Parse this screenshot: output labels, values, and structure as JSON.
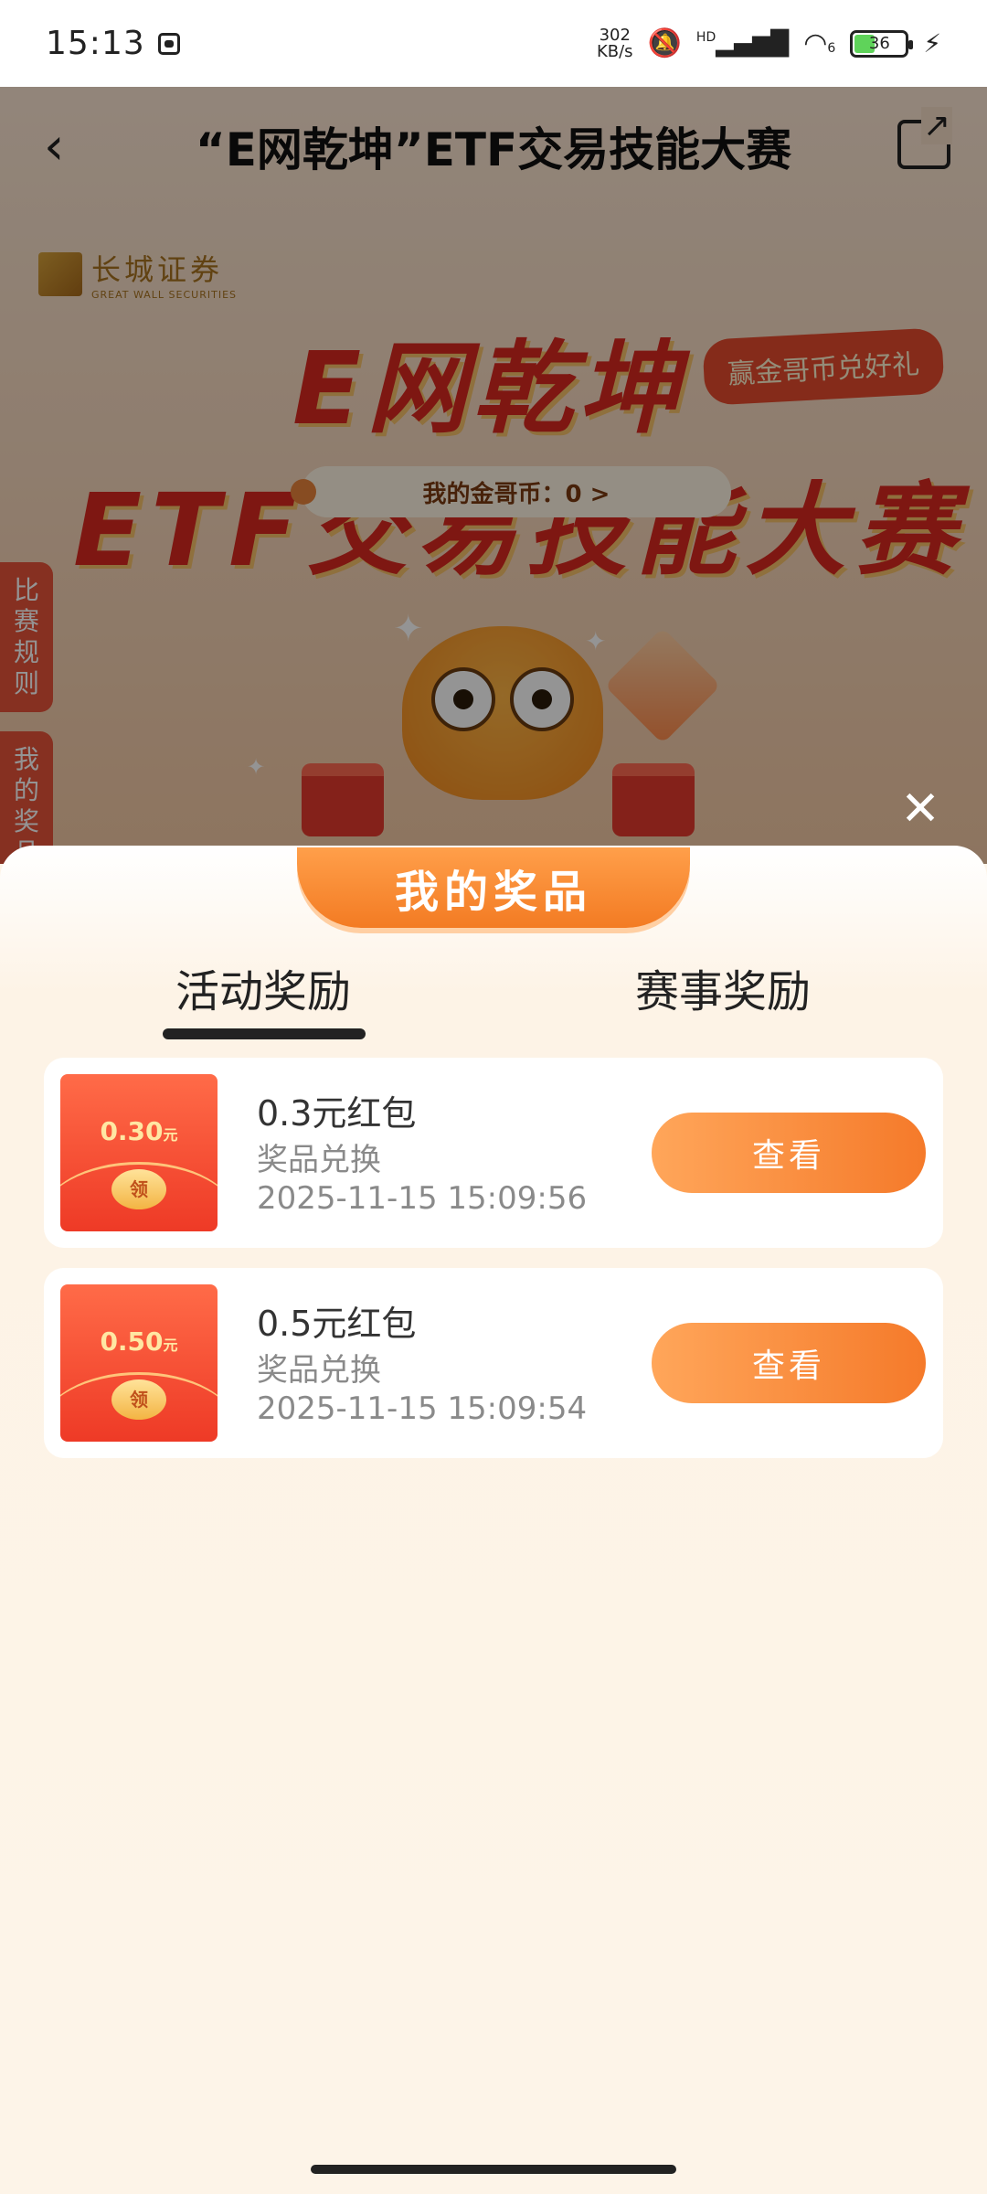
{
  "status_bar": {
    "time": "15:13",
    "net_speed_value": "302",
    "net_speed_unit": "KB/s",
    "signal_label": "HD",
    "wifi_label": "6",
    "battery": "36"
  },
  "page": {
    "title": "“E网乾坤”ETF交易技能大赛",
    "brand_cn": "长城证券",
    "brand_en": "GREAT WALL SECURITIES",
    "hero_line1": "E网乾坤",
    "hero_line2": "ETF交易技能大赛",
    "hero_badge": "赢金哥币兑好礼",
    "coins_label": "我的金哥币：0 >",
    "side_rules": "比赛规则",
    "side_prizes": "我的奖品"
  },
  "sheet": {
    "title": "我的奖品",
    "tabs": [
      {
        "label": "活动奖励",
        "active": true
      },
      {
        "label": "赛事奖励",
        "active": false
      }
    ],
    "prizes": [
      {
        "envelope_amount": "0.30",
        "envelope_unit": "元",
        "seal": "领",
        "name": "0.3元红包",
        "type": "奖品兑换",
        "time": "2025-11-15 15:09:56",
        "button": "查看"
      },
      {
        "envelope_amount": "0.50",
        "envelope_unit": "元",
        "seal": "领",
        "name": "0.5元红包",
        "type": "奖品兑换",
        "time": "2025-11-15 15:09:54",
        "button": "查看"
      }
    ]
  },
  "colors": {
    "accent": "#f57a2a",
    "sheet_bg": "#fdf4e8",
    "envelope": "#ee3a26"
  }
}
